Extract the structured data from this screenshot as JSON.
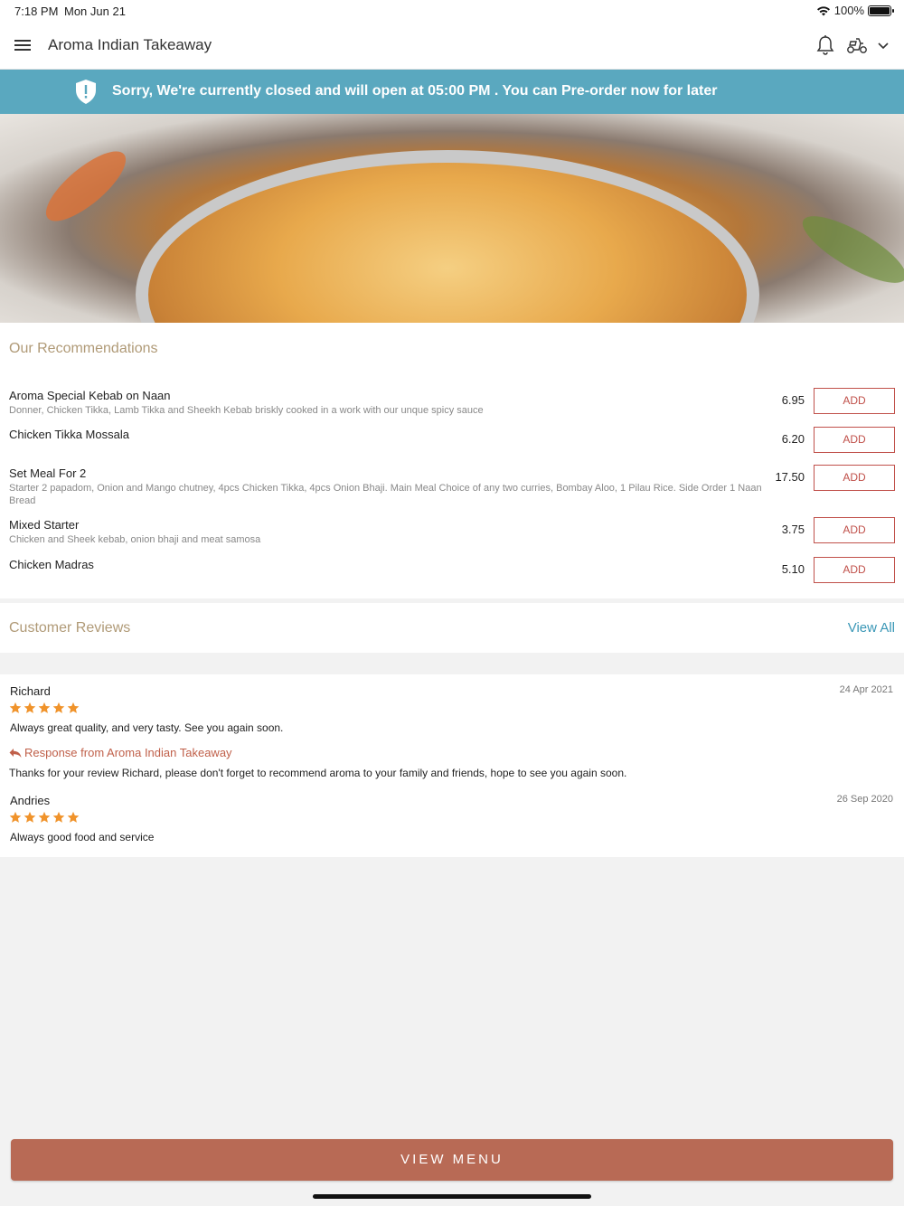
{
  "status_bar": {
    "time": "7:18 PM",
    "date": "Mon Jun 21",
    "battery": "100%"
  },
  "header": {
    "title": "Aroma Indian Takeaway"
  },
  "banner": {
    "message": "Sorry, We're currently closed and will open at 05:00 PM . You can Pre-order now for later",
    "color": "#5aa8bf"
  },
  "recommendations": {
    "title": "Our Recommendations",
    "add_label": "ADD",
    "items": [
      {
        "name": "Aroma Special Kebab on Naan",
        "description": "Donner, Chicken Tikka, Lamb Tikka and Sheekh Kebab briskly cooked in a work with our unque spicy sauce",
        "price": "6.95"
      },
      {
        "name": "Chicken Tikka Mossala",
        "description": "",
        "price": "6.20"
      },
      {
        "name": "Set Meal For 2",
        "description": "Starter 2 papadom, Onion and Mango chutney, 4pcs Chicken Tikka, 4pcs Onion Bhaji. Main Meal Choice of any two curries, Bombay Aloo, 1 Pilau Rice. Side Order 1 Naan Bread",
        "price": "17.50"
      },
      {
        "name": "Mixed Starter",
        "description": "Chicken and Sheek kebab, onion bhaji and meat samosa",
        "price": "3.75"
      },
      {
        "name": "Chicken Madras",
        "description": "",
        "price": "5.10"
      }
    ]
  },
  "reviews": {
    "title": "Customer Reviews",
    "view_all": "View All",
    "items": [
      {
        "author": "Richard",
        "date": "24 Apr 2021",
        "rating": 5,
        "text": "Always great quality, and very tasty. See you again soon.",
        "response_label": "Response from Aroma Indian Takeaway",
        "response_text": "Thanks for your review Richard, please don't forget to recommend aroma to your family and friends, hope to see you again soon."
      },
      {
        "author": "Andries",
        "date": "26 Sep 2020",
        "rating": 5,
        "text": "Always good food and service"
      }
    ]
  },
  "cta": {
    "label": "VIEW MENU",
    "color": "#b86a55"
  },
  "icons": {
    "menu": "hamburger-menu-icon",
    "bell": "bell-icon",
    "scooter": "delivery-scooter-icon",
    "chevron": "chevron-down-icon",
    "shield": "shield-alert-icon",
    "star": "star-icon",
    "reply": "reply-arrow-icon"
  }
}
